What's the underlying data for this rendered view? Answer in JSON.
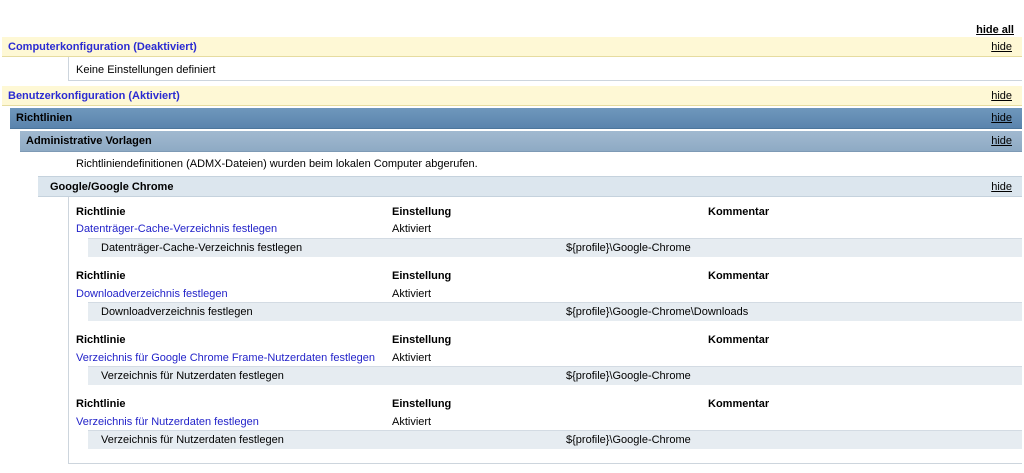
{
  "hide_all": "hide all",
  "hide": "hide",
  "computer_config": {
    "title": "Computerkonfiguration (Deaktiviert)",
    "note": "Keine Einstellungen definiert"
  },
  "user_config": {
    "title": "Benutzerkonfiguration (Aktiviert)",
    "policies": {
      "title": "Richtlinien",
      "admin_templates": {
        "title": "Administrative Vorlagen",
        "note": "Richtliniendefinitionen (ADMX-Dateien) wurden beim lokalen Computer abgerufen.",
        "category": {
          "title": "Google/Google Chrome",
          "columns": {
            "policy": "Richtlinie",
            "setting": "Einstellung",
            "comment": "Kommentar"
          },
          "entries": [
            {
              "policy": "Datenträger-Cache-Verzeichnis festlegen",
              "setting": "Aktiviert",
              "sub_label": "Datenträger-Cache-Verzeichnis festlegen",
              "sub_value": "${profile}\\Google-Chrome"
            },
            {
              "policy": "Downloadverzeichnis festlegen",
              "setting": "Aktiviert",
              "sub_label": "Downloadverzeichnis festlegen",
              "sub_value": "${profile}\\Google-Chrome\\Downloads"
            },
            {
              "policy": "Verzeichnis für Google Chrome Frame-Nutzerdaten festlegen",
              "setting": "Aktiviert",
              "sub_label": "Verzeichnis für Nutzerdaten festlegen",
              "sub_value": "${profile}\\Google-Chrome"
            },
            {
              "policy": "Verzeichnis für Nutzerdaten festlegen",
              "setting": "Aktiviert",
              "sub_label": "Verzeichnis für Nutzerdaten festlegen",
              "sub_value": "${profile}\\Google-Chrome"
            }
          ]
        }
      }
    }
  }
}
